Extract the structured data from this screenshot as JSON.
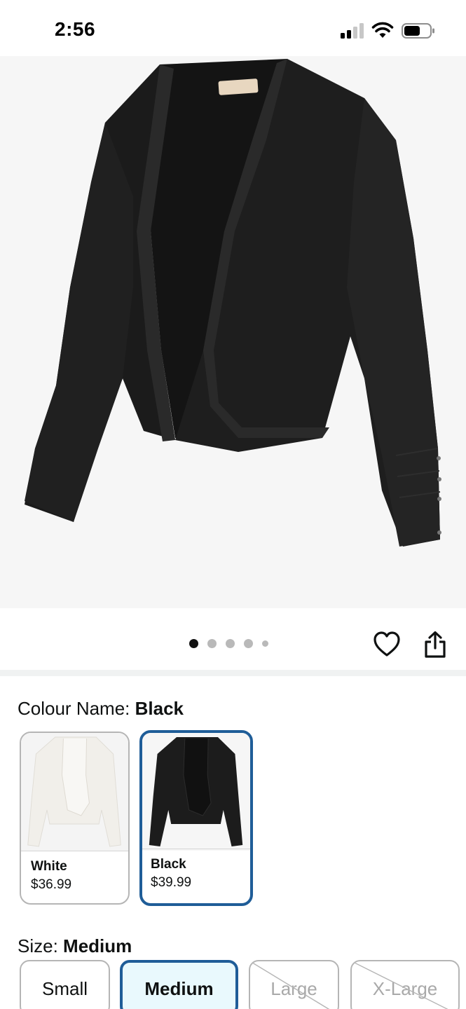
{
  "status_bar": {
    "time": "2:56",
    "icons": [
      "cellular-signal-icon",
      "wifi-icon",
      "battery-icon"
    ]
  },
  "product_image": {
    "description_icon": "black-cardigan-image",
    "gallery_pages": 5,
    "active_page": 1
  },
  "actions": {
    "icons": [
      "heart-icon",
      "share-icon"
    ]
  },
  "colour": {
    "label": "Colour Name:",
    "selected": "Black",
    "options": [
      {
        "name": "White",
        "price": "$36.99",
        "selected": false,
        "swatch_color": "#f1efea"
      },
      {
        "name": "Black",
        "price": "$39.99",
        "selected": true,
        "swatch_color": "#1a1a1a"
      }
    ]
  },
  "size": {
    "label": "Size:",
    "selected": "Medium",
    "options": [
      {
        "label": "Small",
        "selected": false,
        "available": true
      },
      {
        "label": "Medium",
        "selected": true,
        "available": true
      },
      {
        "label": "Large",
        "selected": false,
        "available": false
      },
      {
        "label": "X-Large",
        "selected": false,
        "available": false
      }
    ]
  },
  "colors": {
    "accent_border": "#1f5d98",
    "selected_fill": "#e9f9fd",
    "hero_background": "#f6f6f6"
  }
}
